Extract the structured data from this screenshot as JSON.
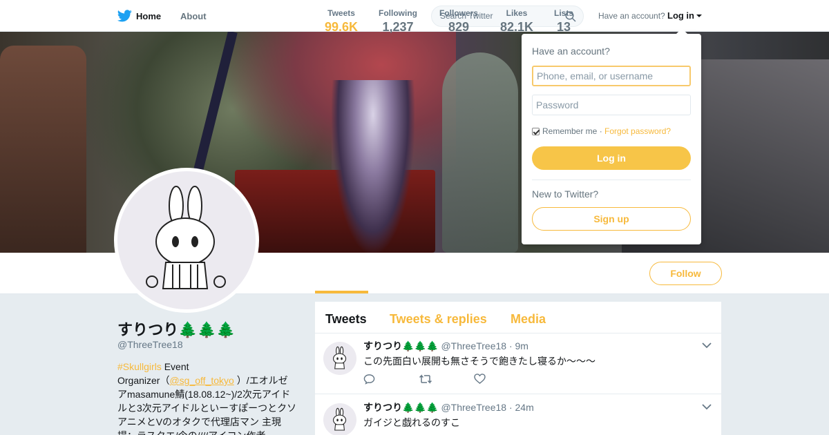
{
  "nav": {
    "home_label": "Home",
    "about_label": "About",
    "search_placeholder": "Search Twitter",
    "have_account": "Have an account?",
    "login_label": "Log in"
  },
  "profile": {
    "name": "すりつり🌲🌲🌲",
    "handle": "@ThreeTree18",
    "bio_lines": [
      {
        "hashtag": "#Skullgirls",
        "after": " Event"
      },
      {
        "before": "Organizer（",
        "mention": "@sg_off_tokyo",
        "after": " ）/エオルゼ"
      },
      {
        "text": "アmasamune鯖(18.08.12~)/2次元アイド"
      },
      {
        "text": "ルと3次元アイドルといーすぽーつとクソ"
      },
      {
        "text": "アニメとVのオタクで代理店マン 主現"
      },
      {
        "text": "場：ラスクエ/今の////アイコン作者"
      }
    ]
  },
  "stats": [
    {
      "label": "Tweets",
      "value": "99.6K"
    },
    {
      "label": "Following",
      "value": "1,237"
    },
    {
      "label": "Followers",
      "value": "829"
    },
    {
      "label": "Likes",
      "value": "82.1K"
    },
    {
      "label": "Lists",
      "value": "13"
    }
  ],
  "follow_label": "Follow",
  "tabs": [
    "Tweets",
    "Tweets & replies",
    "Media"
  ],
  "tweets": [
    {
      "name": "すりつり🌲🌲🌲",
      "handle": "@ThreeTree18",
      "time": "· 9m",
      "text": "この先面白い展開も無さそうで飽きたし寝るか～～～"
    },
    {
      "name": "すりつり🌲🌲🌲",
      "handle": "@ThreeTree18",
      "time": "· 24m",
      "text": "ガイジと戯れるのすこ"
    }
  ],
  "login_dropdown": {
    "title": "Have an account?",
    "username_placeholder": "Phone, email, or username",
    "password_placeholder": "Password",
    "remember_me": "Remember me",
    "separator": " · ",
    "forgot_password": "Forgot password?",
    "login_button": "Log in",
    "new_to_twitter": "New to Twitter?",
    "signup_button": "Sign up"
  },
  "colors": {
    "accent": "#f7b93b",
    "twitter_blue": "#1da1f2",
    "text": "#14171a",
    "muted": "#657786",
    "background": "#e6ecf0"
  },
  "icons": {
    "logo": "twitter-bird-icon",
    "search": "search-icon",
    "reply": "reply-icon",
    "retweet": "retweet-icon",
    "like": "heart-icon",
    "more": "chevron-down-icon"
  }
}
